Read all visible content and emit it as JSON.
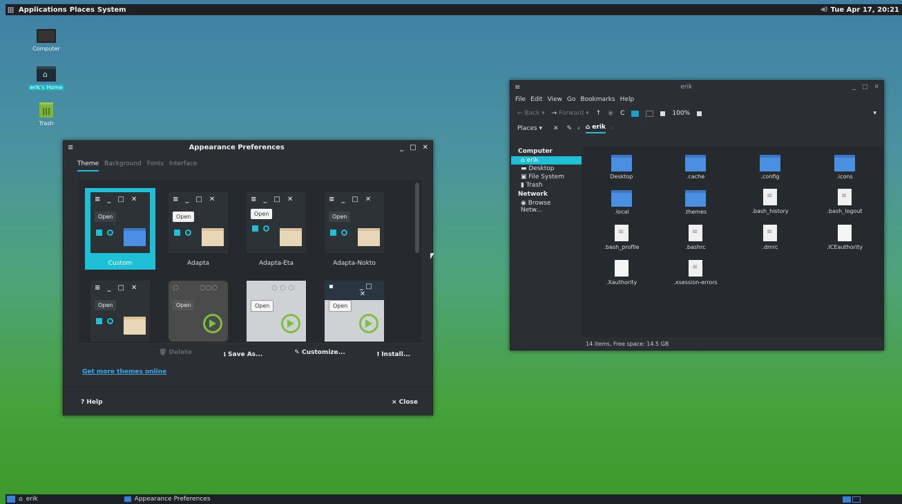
{
  "top_panel": {
    "menus": [
      "Applications",
      "Places",
      "System"
    ],
    "clock": "Tue Apr 17, 20:21"
  },
  "desktop_icons": [
    {
      "label": "Computer",
      "icon": "computer-icon"
    },
    {
      "label": "erik's Home",
      "icon": "home-folder-icon",
      "selected": true
    },
    {
      "label": "Trash",
      "icon": "trash-icon"
    }
  ],
  "appearance": {
    "title": "Appearance Preferences",
    "tabs": [
      "Theme",
      "Background",
      "Fonts",
      "Interface"
    ],
    "themes": [
      {
        "name": "Custom",
        "open_label": "Open"
      },
      {
        "name": "Adapta",
        "open_label": "Open"
      },
      {
        "name": "Adapta-Eta",
        "open_label": "Open"
      },
      {
        "name": "Adapta-Nokto",
        "open_label": "Open"
      },
      {
        "name": "",
        "open_label": "Open"
      },
      {
        "name": "",
        "open_label": "Open"
      },
      {
        "name": "",
        "open_label": "Open"
      },
      {
        "name": "",
        "open_label": "Open"
      }
    ],
    "actions": {
      "delete": "Delete",
      "save_as": "Save As...",
      "customize": "Customize...",
      "install": "Install..."
    },
    "link": "Get more themes online",
    "help": "? Help",
    "close": "× Close"
  },
  "filemgr": {
    "title": "erik",
    "menu": [
      "File",
      "Edit",
      "View",
      "Go",
      "Bookmarks",
      "Help"
    ],
    "toolbar": {
      "back": "Back",
      "forward": "Forward",
      "zoom": "100%"
    },
    "places_label": "Places",
    "crumb": "erik",
    "sidebar": {
      "computer_header": "Computer",
      "computer_items": [
        "erik",
        "Desktop",
        "File System",
        "Trash"
      ],
      "network_header": "Network",
      "network_items": [
        "Browse Netw..."
      ]
    },
    "files": [
      {
        "name": "Desktop",
        "type": "folder"
      },
      {
        "name": ".cache",
        "type": "folder"
      },
      {
        "name": ".config",
        "type": "folder"
      },
      {
        "name": ".icons",
        "type": "folder"
      },
      {
        "name": ".local",
        "type": "folder"
      },
      {
        "name": ".themes",
        "type": "folder"
      },
      {
        "name": ".bash_history",
        "type": "doc"
      },
      {
        "name": ".bash_logout",
        "type": "doc"
      },
      {
        "name": ".bash_profile",
        "type": "doc"
      },
      {
        "name": ".bashrc",
        "type": "doc"
      },
      {
        "name": ".dmrc",
        "type": "doc"
      },
      {
        "name": ".ICEauthority",
        "type": "blank"
      },
      {
        "name": ".Xauthority",
        "type": "blank"
      },
      {
        "name": ".xsession-errors",
        "type": "doc"
      }
    ],
    "status": "14 items, Free space: 14.5 GB"
  },
  "bottom_panel": {
    "task1": "erik",
    "task2": "Appearance Preferences"
  }
}
